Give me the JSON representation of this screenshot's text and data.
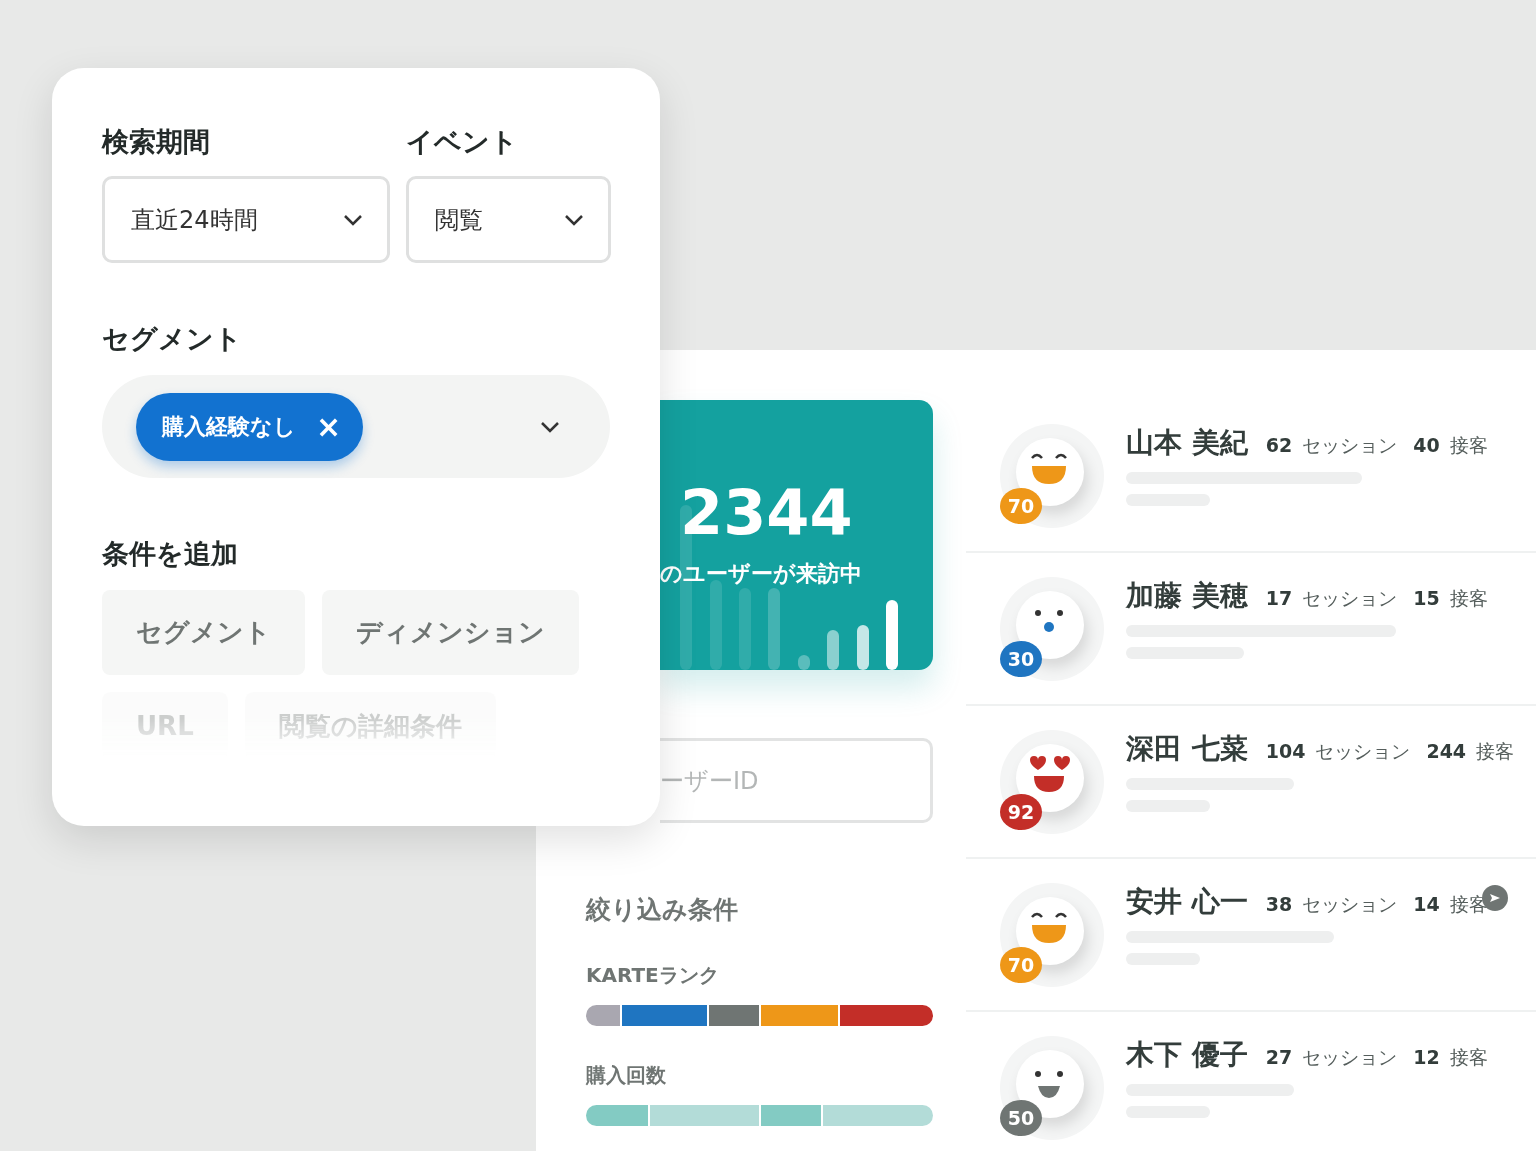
{
  "filter_card": {
    "period_label": "検索期間",
    "period_value": "直近24時間",
    "event_label": "イベント",
    "event_value": "閲覧",
    "segment_label": "セグメント",
    "segment_chip": "購入経験なし",
    "chip_close": "×",
    "add_label": "条件を追加",
    "add_buttons": [
      {
        "label": "セグメント",
        "dimmed": false
      },
      {
        "label": "ディメンション",
        "dimmed": false
      },
      {
        "label": "URL",
        "dimmed": true
      },
      {
        "label": "閲覧の詳細条件",
        "dimmed": true
      }
    ]
  },
  "visitors": {
    "count": "2344",
    "caption": "のユーザーが来訪中"
  },
  "search": {
    "placeholder": "ーザーID"
  },
  "filters": {
    "title": "絞り込み条件",
    "groups": [
      {
        "label": "KARTEランク",
        "kind": "rank"
      },
      {
        "label": "購入回数",
        "kind": "purchases"
      }
    ]
  },
  "users": [
    {
      "name": "山本 美紀",
      "sessions": "62",
      "sessions_label": "セッション",
      "actions": "40",
      "actions_label": "接客",
      "score": "70",
      "color": "#ee9718",
      "kind": "smile",
      "cursor": false
    },
    {
      "name": "加藤 美穂",
      "sessions": "17",
      "sessions_label": "セッション",
      "actions": "15",
      "actions_label": "接客",
      "score": "30",
      "color": "#1f75c1",
      "kind": "surprised",
      "cursor": false
    },
    {
      "name": "深田 七菜",
      "sessions": "104",
      "sessions_label": "セッション",
      "actions": "244",
      "actions_label": "接客",
      "score": "92",
      "color": "#c32e28",
      "kind": "hearts",
      "cursor": false
    },
    {
      "name": "安井 心一",
      "sessions": "38",
      "sessions_label": "セッション",
      "actions": "14",
      "actions_label": "接客",
      "score": "70",
      "color": "#ee9718",
      "kind": "smile",
      "cursor": true
    },
    {
      "name": "木下 優子",
      "sessions": "27",
      "sessions_label": "セッション",
      "actions": "12",
      "actions_label": "接客",
      "score": "50",
      "color": "#6f7573",
      "kind": "neutral",
      "cursor": false
    }
  ]
}
